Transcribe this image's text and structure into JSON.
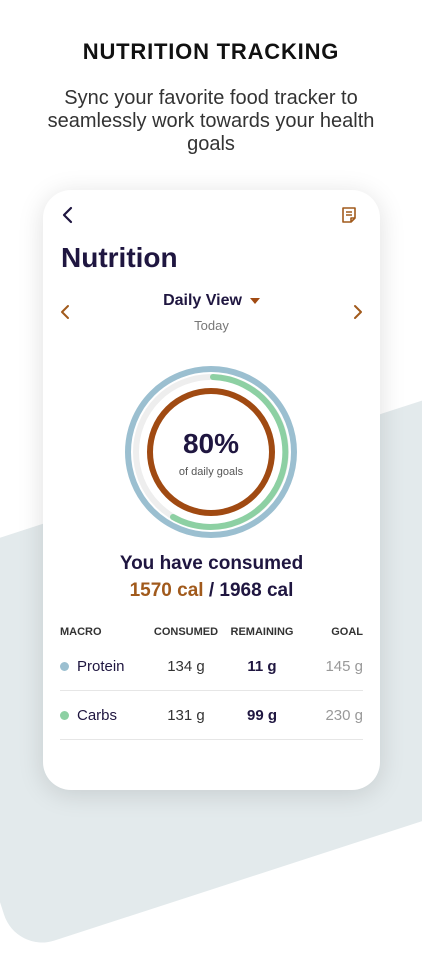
{
  "headline": "NUTRITION TRACKING",
  "subline": "Sync your favorite food tracker to seamlessly work towards your health goals",
  "screen": {
    "title": "Nutrition",
    "view_label": "Daily View",
    "date_label": "Today",
    "ring": {
      "percent_text": "80%",
      "sub_text": "of daily goals",
      "progress": 0.8
    },
    "consumed_text": "You have consumed",
    "calories_consumed": "1570 cal",
    "calories_separator": " / ",
    "calories_goal": "1968 cal"
  },
  "colors": {
    "protein": "#9bbfd0",
    "carbs": "#8dd0a3",
    "calories": "#a04a12",
    "title": "#1f1640"
  },
  "icons": {
    "back": "chevron-left-icon",
    "notes": "notes-icon",
    "prev": "chevron-left-icon",
    "next": "chevron-right-icon"
  },
  "table": {
    "headers": [
      "MACRO",
      "CONSUMED",
      "REMAINING",
      "GOAL"
    ],
    "rows": [
      {
        "name": "Protein",
        "consumed": "134 g",
        "remaining": "11 g",
        "goal": "145 g"
      },
      {
        "name": "Carbs",
        "consumed": "131 g",
        "remaining": "99 g",
        "goal": "230 g"
      }
    ]
  }
}
